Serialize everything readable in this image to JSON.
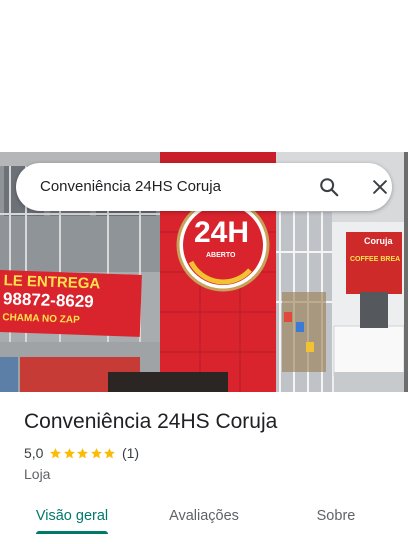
{
  "search": {
    "value": "Conveniência 24HS Coruja"
  },
  "photo": {
    "banner_line1": "LE ENTREGA",
    "banner_phone": "98872-8629",
    "banner_line3": "CHAMA NO ZAP",
    "sign_main": "24H",
    "sign_sub": "ABERTO",
    "right_sign_top": "Coruja",
    "right_sign_bottom": "COFFEE BREA"
  },
  "place": {
    "name": "Conveniência 24HS Coruja",
    "rating": "5,0",
    "stars": 5,
    "review_count": "(1)",
    "category": "Loja"
  },
  "tabs": [
    {
      "label": "Visão geral",
      "active": true
    },
    {
      "label": "Avaliações",
      "active": false
    },
    {
      "label": "Sobre",
      "active": false
    }
  ],
  "colors": {
    "accent": "#00796b",
    "star": "#fbbc04",
    "storefront_red": "#d9232d"
  },
  "icons": {
    "search": "search-icon",
    "close": "close-icon",
    "star": "star-icon"
  }
}
